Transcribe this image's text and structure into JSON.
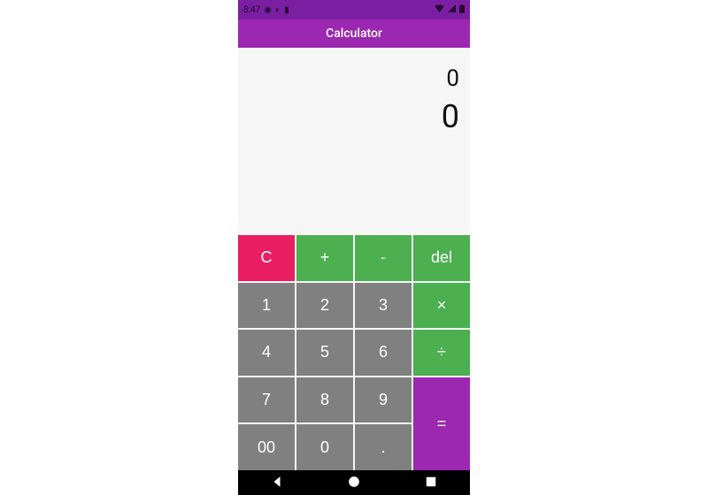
{
  "statusbar": {
    "time": "8:47"
  },
  "appbar": {
    "title": "Calculator"
  },
  "display": {
    "expression": "0",
    "result": "0"
  },
  "keys": {
    "clear": "C",
    "plus": "+",
    "minus": "-",
    "delete": "del",
    "multiply": "×",
    "divide": "÷",
    "equals": "=",
    "d1": "1",
    "d2": "2",
    "d3": "3",
    "d4": "4",
    "d5": "5",
    "d6": "6",
    "d7": "7",
    "d8": "8",
    "d9": "9",
    "d00": "00",
    "d0": "0",
    "dot": "."
  }
}
